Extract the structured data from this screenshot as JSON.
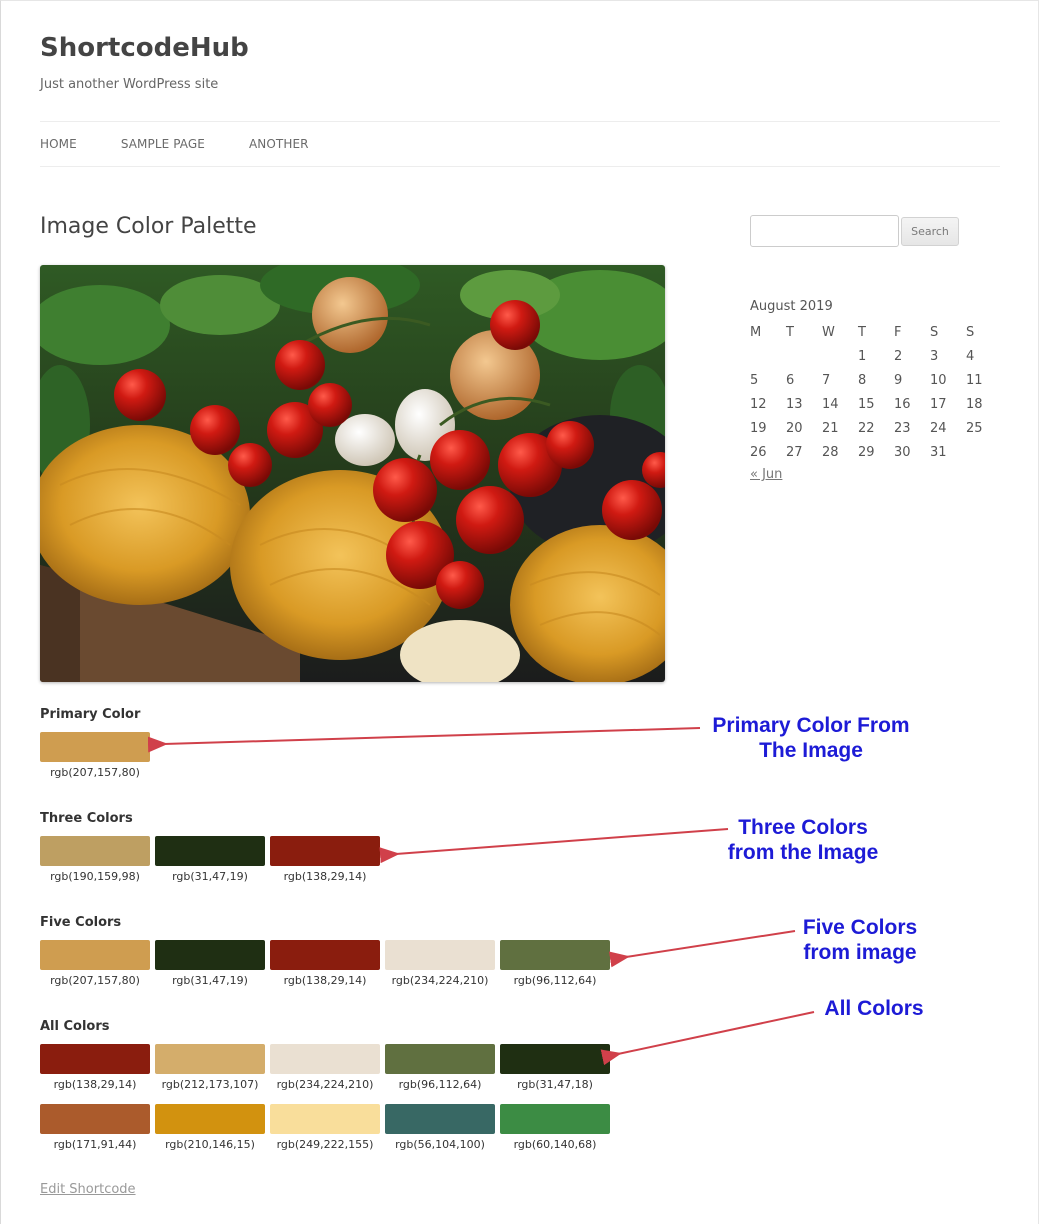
{
  "site": {
    "title": "ShortcodeHub",
    "description": "Just another WordPress site"
  },
  "nav": {
    "items": [
      "HOME",
      "SAMPLE PAGE",
      "ANOTHER"
    ]
  },
  "main": {
    "title": "Image Color Palette",
    "edit_link": "Edit Shortcode"
  },
  "palette": {
    "primary": {
      "label": "Primary Color",
      "colors": [
        {
          "hex": "#cf9d50",
          "label": "rgb(207,157,80)"
        }
      ]
    },
    "three": {
      "label": "Three Colors",
      "colors": [
        {
          "hex": "#be9f62",
          "label": "rgb(190,159,98)"
        },
        {
          "hex": "#1f2f13",
          "label": "rgb(31,47,19)"
        },
        {
          "hex": "#8a1d0e",
          "label": "rgb(138,29,14)"
        }
      ]
    },
    "five": {
      "label": "Five Colors",
      "colors": [
        {
          "hex": "#cf9d50",
          "label": "rgb(207,157,80)"
        },
        {
          "hex": "#1f2f13",
          "label": "rgb(31,47,19)"
        },
        {
          "hex": "#8a1d0e",
          "label": "rgb(138,29,14)"
        },
        {
          "hex": "#eae0d2",
          "label": "rgb(234,224,210)"
        },
        {
          "hex": "#607040",
          "label": "rgb(96,112,64)"
        }
      ]
    },
    "all": {
      "label": "All Colors",
      "rows": [
        [
          {
            "hex": "#8a1d0e",
            "label": "rgb(138,29,14)"
          },
          {
            "hex": "#d4ad6b",
            "label": "rgb(212,173,107)"
          },
          {
            "hex": "#eae0d2",
            "label": "rgb(234,224,210)"
          },
          {
            "hex": "#607040",
            "label": "rgb(96,112,64)"
          },
          {
            "hex": "#1f2f12",
            "label": "rgb(31,47,18)"
          }
        ],
        [
          {
            "hex": "#ab5b2c",
            "label": "rgb(171,91,44)"
          },
          {
            "hex": "#d2920f",
            "label": "rgb(210,146,15)"
          },
          {
            "hex": "#f9de9b",
            "label": "rgb(249,222,155)"
          },
          {
            "hex": "#386864",
            "label": "rgb(56,104,100)"
          },
          {
            "hex": "#3c8c44",
            "label": "rgb(60,140,68)"
          }
        ]
      ]
    }
  },
  "sidebar": {
    "search_button": "Search",
    "search_placeholder": "",
    "calendar": {
      "caption": "August 2019",
      "days": [
        "M",
        "T",
        "W",
        "T",
        "F",
        "S",
        "S"
      ],
      "weeks": [
        [
          "",
          "",
          "",
          "1",
          "2",
          "3",
          "4"
        ],
        [
          "5",
          "6",
          "7",
          "8",
          "9",
          "10",
          "11"
        ],
        [
          "12",
          "13",
          "14",
          "15",
          "16",
          "17",
          "18"
        ],
        [
          "19",
          "20",
          "21",
          "22",
          "23",
          "24",
          "25"
        ],
        [
          "26",
          "27",
          "28",
          "29",
          "30",
          "31",
          ""
        ]
      ],
      "prev_link": "« Jun"
    }
  },
  "annotations": {
    "primary": [
      "Primary Color From",
      "The Image"
    ],
    "three": [
      "Three Colors",
      "from the Image"
    ],
    "five": [
      "Five Colors",
      "from image"
    ],
    "all": [
      "All Colors"
    ],
    "text_color": "#1d1bd6",
    "arrow_color": "#d0404a"
  }
}
